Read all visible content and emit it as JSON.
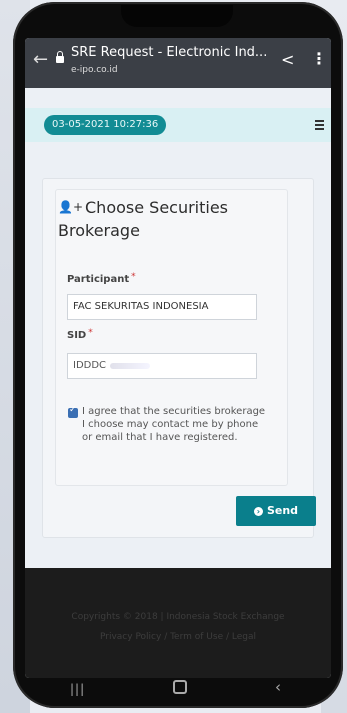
{
  "browser": {
    "title": "SRE Request - Electronic Ind...",
    "url": "e-ipo.co.id",
    "back_icon": "arrow-left-icon",
    "share_icon": "share-icon",
    "menu_icon": "more-vertical-icon"
  },
  "header": {
    "datetime": "03-05-2021 10:27:36",
    "menu_icon": "hamburger-icon"
  },
  "form": {
    "title": "Choose Securities Brokerage",
    "title_icon": "add-user-icon",
    "participant_label": "Participant",
    "participant_value": "FAC SEKURITAS INDONESIA",
    "sid_label": "SID",
    "sid_value": "IDDDC",
    "required_mark": "*",
    "agree_checked": true,
    "agree_text": "I agree that the securities brokerage I choose may contact me by phone or email that I have registered.",
    "send_label": "Send",
    "send_icon": "arrow-circle-icon"
  },
  "footer": {
    "copyright": "Copyrights © 2018 | Indonesia Stock Exchange",
    "links": "Privacy Policy / Term of Use / Legal"
  },
  "colors": {
    "accent": "#0a7f8c",
    "badge": "#128c94",
    "topbar": "#d9f0f3"
  }
}
